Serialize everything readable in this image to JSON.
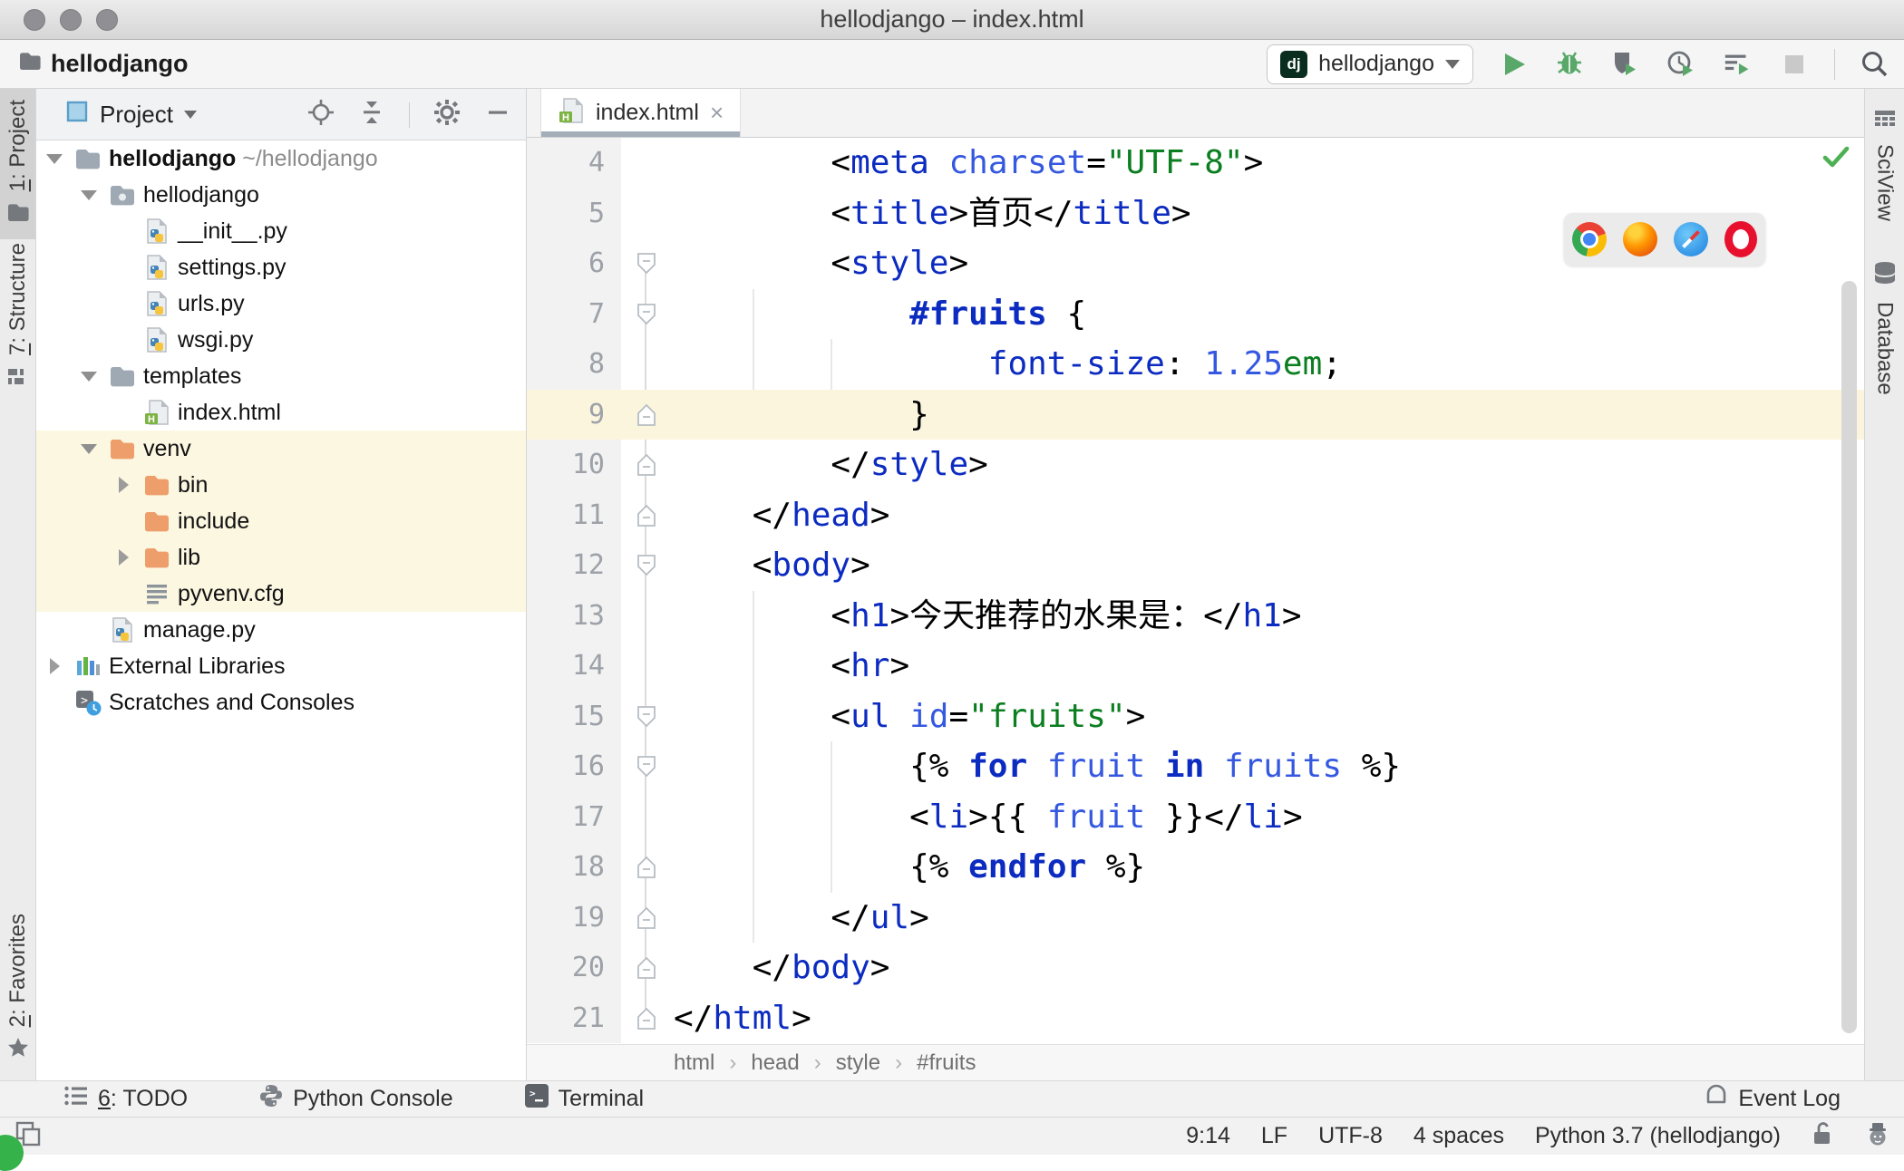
{
  "window": {
    "title": "hellodjango – index.html"
  },
  "toolbar": {
    "project_name": "hellodjango",
    "run_config": {
      "badge": "dj",
      "label": "hellodjango"
    },
    "buttons": [
      "run",
      "debug",
      "coverage",
      "profile",
      "concurrency",
      "stop",
      "search"
    ]
  },
  "left_stripe": {
    "top": [
      {
        "label": "1: Project",
        "icon": "project-folder-icon",
        "active": true
      },
      {
        "label": "7: Structure",
        "icon": "structure-icon",
        "active": false
      }
    ],
    "bottom": [
      {
        "label": "2: Favorites",
        "icon": "star-icon",
        "active": false
      }
    ]
  },
  "right_stripe": [
    {
      "label": "SciView",
      "icon": "sciview-icon"
    },
    {
      "label": "Database",
      "icon": "database-icon"
    }
  ],
  "project_panel": {
    "header": {
      "title": "Project"
    },
    "tree": [
      {
        "label": "hellodjango",
        "path": " ~/hellodjango",
        "level": 0,
        "icon": "folder",
        "chevron": "down",
        "bold": true,
        "highlight": false
      },
      {
        "label": "hellodjango",
        "level": 1,
        "icon": "folder-package",
        "chevron": "down",
        "highlight": false
      },
      {
        "label": "__init__.py",
        "level": 2,
        "icon": "python-file",
        "chevron": null,
        "highlight": false
      },
      {
        "label": "settings.py",
        "level": 2,
        "icon": "python-file",
        "chevron": null,
        "highlight": false
      },
      {
        "label": "urls.py",
        "level": 2,
        "icon": "python-file",
        "chevron": null,
        "highlight": false
      },
      {
        "label": "wsgi.py",
        "level": 2,
        "icon": "python-file",
        "chevron": null,
        "highlight": false
      },
      {
        "label": "templates",
        "level": 1,
        "icon": "folder",
        "chevron": "down",
        "highlight": false
      },
      {
        "label": "index.html",
        "level": 2,
        "icon": "html-file",
        "chevron": null,
        "highlight": false
      },
      {
        "label": "venv",
        "level": 1,
        "icon": "folder-excluded",
        "chevron": "down",
        "highlight": true
      },
      {
        "label": "bin",
        "level": 2,
        "icon": "folder-excluded",
        "chevron": "right",
        "highlight": true
      },
      {
        "label": "include",
        "level": 2,
        "icon": "folder-excluded",
        "chevron": null,
        "highlight": true
      },
      {
        "label": "lib",
        "level": 2,
        "icon": "folder-excluded",
        "chevron": "right",
        "highlight": true
      },
      {
        "label": "pyvenv.cfg",
        "level": 2,
        "icon": "text-file",
        "chevron": null,
        "highlight": true
      },
      {
        "label": "manage.py",
        "level": 1,
        "icon": "python-file",
        "chevron": null,
        "highlight": false
      },
      {
        "label": "External Libraries",
        "level": 0,
        "icon": "ext-lib",
        "chevron": "right",
        "highlight": false
      },
      {
        "label": "Scratches and Consoles",
        "level": 0,
        "icon": "scratches",
        "chevron": null,
        "highlight": false
      }
    ]
  },
  "editor": {
    "tab": {
      "label": "index.html",
      "close": "×"
    },
    "caret_line": 9,
    "breadcrumbs": [
      "html",
      "head",
      "style",
      "#fruits"
    ],
    "browser_popup": [
      "chrome",
      "firefox",
      "safari",
      "opera"
    ],
    "lines": [
      {
        "no": 4,
        "fold": null,
        "tokens": [
          [
            "        ",
            "p"
          ],
          [
            "<",
            "p"
          ],
          [
            "meta",
            "tag"
          ],
          [
            " ",
            "p"
          ],
          [
            "charset",
            "attr"
          ],
          [
            "=",
            "p"
          ],
          [
            "\"UTF-8\"",
            "val"
          ],
          [
            ">",
            "p"
          ]
        ]
      },
      {
        "no": 5,
        "fold": null,
        "tokens": [
          [
            "        ",
            "p"
          ],
          [
            "<",
            "p"
          ],
          [
            "title",
            "tag"
          ],
          [
            ">",
            "p"
          ],
          [
            "首页",
            "p"
          ],
          [
            "</",
            "p"
          ],
          [
            "title",
            "tag"
          ],
          [
            ">",
            "p"
          ]
        ]
      },
      {
        "no": 6,
        "fold": "down",
        "tokens": [
          [
            "        ",
            "p"
          ],
          [
            "<",
            "p"
          ],
          [
            "style",
            "tag"
          ],
          [
            ">",
            "p"
          ]
        ]
      },
      {
        "no": 7,
        "fold": "down",
        "tokens": [
          [
            "            ",
            "p"
          ],
          [
            "#fruits",
            "sel"
          ],
          [
            " {",
            "p"
          ]
        ]
      },
      {
        "no": 8,
        "fold": null,
        "tokens": [
          [
            "                ",
            "p"
          ],
          [
            "font-size",
            "prop"
          ],
          [
            ": ",
            "p"
          ],
          [
            "1.25",
            "num"
          ],
          [
            "em",
            "unit"
          ],
          [
            ";",
            "p"
          ]
        ]
      },
      {
        "no": 9,
        "fold": "up",
        "tokens": [
          [
            "            }",
            "p"
          ]
        ]
      },
      {
        "no": 10,
        "fold": "up",
        "tokens": [
          [
            "        ",
            "p"
          ],
          [
            "</",
            "p"
          ],
          [
            "style",
            "tag"
          ],
          [
            ">",
            "p"
          ]
        ]
      },
      {
        "no": 11,
        "fold": "up",
        "tokens": [
          [
            "    ",
            "p"
          ],
          [
            "</",
            "p"
          ],
          [
            "head",
            "tag"
          ],
          [
            ">",
            "p"
          ]
        ]
      },
      {
        "no": 12,
        "fold": "down",
        "tokens": [
          [
            "    ",
            "p"
          ],
          [
            "<",
            "p"
          ],
          [
            "body",
            "tag"
          ],
          [
            ">",
            "p"
          ]
        ]
      },
      {
        "no": 13,
        "fold": null,
        "tokens": [
          [
            "        ",
            "p"
          ],
          [
            "<",
            "p"
          ],
          [
            "h1",
            "tag"
          ],
          [
            ">",
            "p"
          ],
          [
            "今天推荐的水果是：",
            "p"
          ],
          [
            "</",
            "p"
          ],
          [
            "h1",
            "tag"
          ],
          [
            ">",
            "p"
          ]
        ]
      },
      {
        "no": 14,
        "fold": null,
        "tokens": [
          [
            "        ",
            "p"
          ],
          [
            "<",
            "p"
          ],
          [
            "hr",
            "tag"
          ],
          [
            ">",
            "p"
          ]
        ]
      },
      {
        "no": 15,
        "fold": "down",
        "tokens": [
          [
            "        ",
            "p"
          ],
          [
            "<",
            "p"
          ],
          [
            "ul",
            "tag"
          ],
          [
            " ",
            "p"
          ],
          [
            "id",
            "attr"
          ],
          [
            "=",
            "p"
          ],
          [
            "\"fruits\"",
            "val"
          ],
          [
            ">",
            "p"
          ]
        ]
      },
      {
        "no": 16,
        "fold": "down",
        "tokens": [
          [
            "            ",
            "p"
          ],
          [
            "{% ",
            "p"
          ],
          [
            "for",
            "kw"
          ],
          [
            " ",
            "p"
          ],
          [
            "fruit",
            "var"
          ],
          [
            " ",
            "p"
          ],
          [
            "in",
            "kw"
          ],
          [
            " ",
            "p"
          ],
          [
            "fruits",
            "var"
          ],
          [
            " ",
            "p"
          ],
          [
            "%}",
            "p"
          ]
        ]
      },
      {
        "no": 17,
        "fold": null,
        "tokens": [
          [
            "            ",
            "p"
          ],
          [
            "<",
            "p"
          ],
          [
            "li",
            "tag"
          ],
          [
            ">",
            "p"
          ],
          [
            "{{ ",
            "p"
          ],
          [
            "fruit",
            "var"
          ],
          [
            " }}",
            "p"
          ],
          [
            "</",
            "p"
          ],
          [
            "li",
            "tag"
          ],
          [
            ">",
            "p"
          ]
        ]
      },
      {
        "no": 18,
        "fold": "up",
        "tokens": [
          [
            "            ",
            "p"
          ],
          [
            "{% ",
            "p"
          ],
          [
            "endfor",
            "kw"
          ],
          [
            " ",
            "p"
          ],
          [
            "%}",
            "p"
          ]
        ]
      },
      {
        "no": 19,
        "fold": "up",
        "tokens": [
          [
            "        ",
            "p"
          ],
          [
            "</",
            "p"
          ],
          [
            "ul",
            "tag"
          ],
          [
            ">",
            "p"
          ]
        ]
      },
      {
        "no": 20,
        "fold": "up",
        "tokens": [
          [
            "    ",
            "p"
          ],
          [
            "</",
            "p"
          ],
          [
            "body",
            "tag"
          ],
          [
            ">",
            "p"
          ]
        ]
      },
      {
        "no": 21,
        "fold": "up",
        "tokens": [
          [
            "</",
            "p"
          ],
          [
            "html",
            "tag"
          ],
          [
            ">",
            "p"
          ]
        ]
      }
    ]
  },
  "bottom_bar": {
    "left": [
      {
        "label": "6: TODO",
        "icon": "todo-icon"
      },
      {
        "label": "Python Console",
        "icon": "python-console-icon"
      },
      {
        "label": "Terminal",
        "icon": "terminal-icon"
      }
    ],
    "right": [
      {
        "label": "Event Log",
        "icon": "event-log-icon"
      }
    ]
  },
  "status_bar": {
    "items": [
      "9:14",
      "LF",
      "UTF-8",
      "4 spaces",
      "Python 3.7 (hellodjango)"
    ],
    "icons": [
      "unlocked-icon",
      "hector-icon"
    ]
  },
  "colors": {
    "tag_blue": "#0c2bc0",
    "attr_blue": "#3558e0",
    "string_green": "#0b7e20",
    "caret_line": "#fbf5de",
    "tree_highlight": "#fcf7e1",
    "excluded_folder": "#ee9e6a",
    "folder_gray": "#9fa9b3",
    "run_green": "#59a869",
    "django_badge": "#092e20",
    "tab_underline": "#a3aeb9"
  }
}
